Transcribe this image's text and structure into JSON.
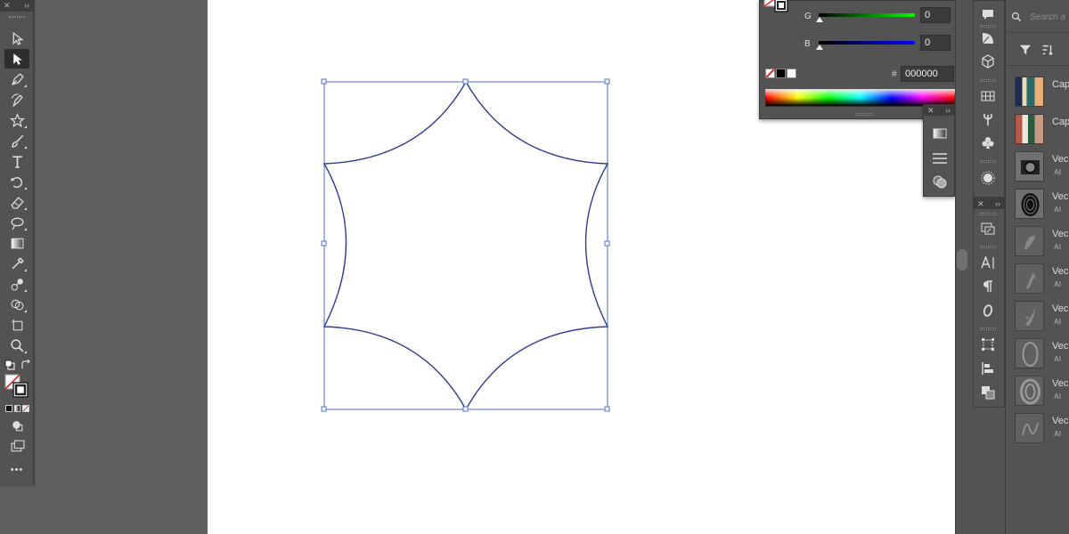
{
  "toolbar": {
    "tools": [
      {
        "name": "selection-tool",
        "icon": "arrow-outline-icon"
      },
      {
        "name": "direct-selection-tool",
        "icon": "arrow-solid-icon",
        "active": true
      },
      {
        "name": "pen-tool",
        "icon": "pen-icon"
      },
      {
        "name": "curvature-tool",
        "icon": "curvature-pen-icon"
      },
      {
        "name": "star-tool",
        "icon": "star-icon"
      },
      {
        "name": "paintbrush-tool",
        "icon": "brush-icon"
      },
      {
        "name": "type-tool",
        "icon": "type-icon"
      },
      {
        "name": "rotate-tool",
        "icon": "rotate-icon"
      },
      {
        "name": "eraser-tool",
        "icon": "eraser-icon"
      },
      {
        "name": "warp-tool",
        "icon": "warp-icon"
      },
      {
        "name": "gradient-tool",
        "icon": "gradient-icon"
      },
      {
        "name": "eyedropper-tool",
        "icon": "eyedropper-icon"
      },
      {
        "name": "blend-tool",
        "icon": "blend-icon"
      },
      {
        "name": "shape-builder-tool",
        "icon": "shape-builder-icon"
      },
      {
        "name": "artboard-tool",
        "icon": "artboard-icon"
      },
      {
        "name": "zoom-tool",
        "icon": "zoom-icon"
      }
    ],
    "more_label": "•••"
  },
  "color_panel": {
    "g_label": "G",
    "g_value": "0",
    "b_label": "B",
    "b_value": "0",
    "hex_label": "#",
    "hex_value": "000000"
  },
  "libraries": {
    "search_placeholder": "Search a",
    "items": [
      {
        "name": "Cap",
        "type": ""
      },
      {
        "name": "Cap",
        "type": ""
      },
      {
        "name": "Vec",
        "type": "AI"
      },
      {
        "name": "Vec",
        "type": "AI"
      },
      {
        "name": "Vec",
        "type": "AI"
      },
      {
        "name": "Vec",
        "type": "AI"
      },
      {
        "name": "Vec",
        "type": "AI"
      },
      {
        "name": "Vec",
        "type": "AI"
      },
      {
        "name": "Vec",
        "type": "AI"
      },
      {
        "name": "Vec",
        "type": "AI"
      }
    ]
  },
  "colors": {
    "selection": "#4a6fd6",
    "path_stroke": "#2f3f8f",
    "panel_bg": "#535353",
    "pasteboard": "#5f5f5f"
  }
}
